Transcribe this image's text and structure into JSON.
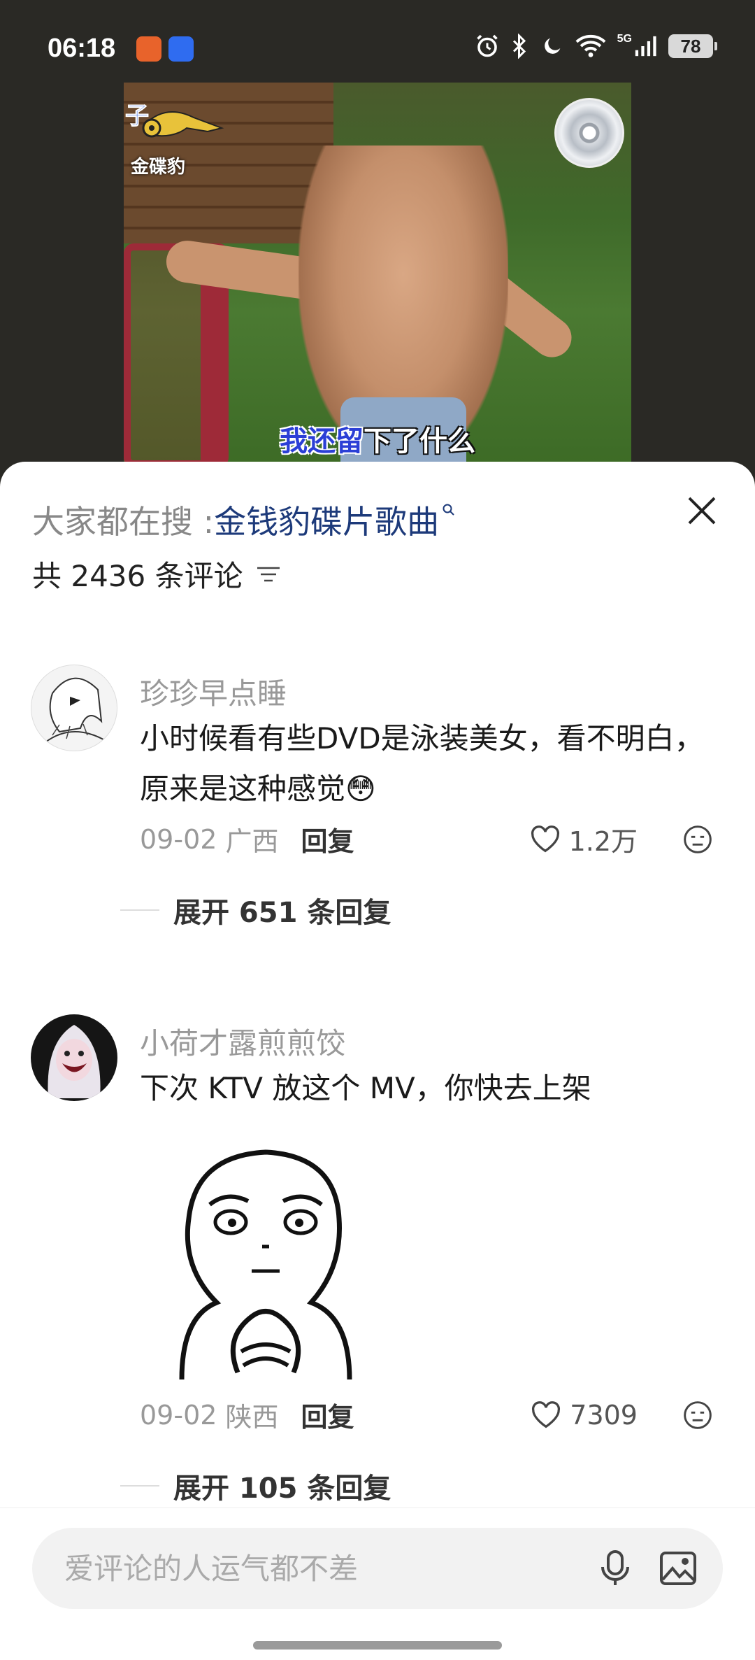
{
  "status_bar": {
    "time": "06:18",
    "network": "5G",
    "battery": "78",
    "icons": [
      "alarm-icon",
      "bluetooth-icon",
      "moon-icon",
      "wifi-icon",
      "signal-icon"
    ]
  },
  "video": {
    "logo_char": "子",
    "logo_text": "金碟豹",
    "subtitle_highlight": "我还留",
    "subtitle_rest": "下了什么"
  },
  "sheet": {
    "search_prefix": "大家都在搜 : ",
    "search_term": "金钱豹碟片歌曲",
    "count_text": "共 2436 条评论"
  },
  "comments": [
    {
      "username": "珍珍早点睡",
      "content": "小时候看有些DVD是泳装美女，看不明白，原来是这种感觉",
      "emoji": "😳",
      "date": "09-02",
      "location": "广西",
      "reply_label": "回复",
      "likes": "1.2万",
      "expand_text": "展开 651 条回复"
    },
    {
      "username": "小荷才露煎煎饺",
      "content": "下次 KTV 放这个 MV，你快去上架",
      "date": "09-02",
      "location": "陕西",
      "reply_label": "回复",
      "likes": "7309",
      "expand_text": "展开 105 条回复"
    }
  ],
  "input": {
    "placeholder": "爱评论的人运气都不差"
  },
  "colors": {
    "accent_link": "#1d3a7a",
    "meta_gray": "#999999",
    "video_bg": "#2a2925"
  }
}
